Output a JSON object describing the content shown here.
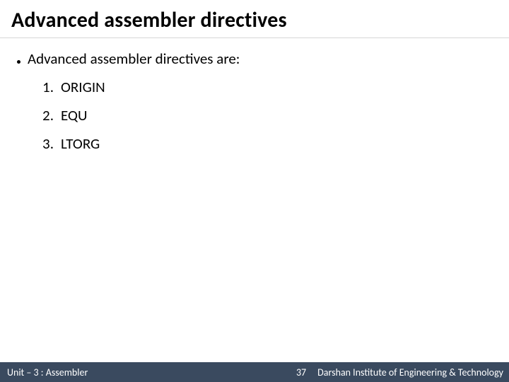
{
  "title": "Advanced assembler directives",
  "bullet": "Advanced assembler directives are:",
  "items": [
    {
      "n": "1.",
      "label": "ORIGIN"
    },
    {
      "n": "2.",
      "label": "EQU"
    },
    {
      "n": "3.",
      "label": "LTORG"
    }
  ],
  "footer": {
    "unit": "Unit – 3  : Assembler",
    "page": "37",
    "institute": "Darshan Institute of Engineering & Technology"
  }
}
